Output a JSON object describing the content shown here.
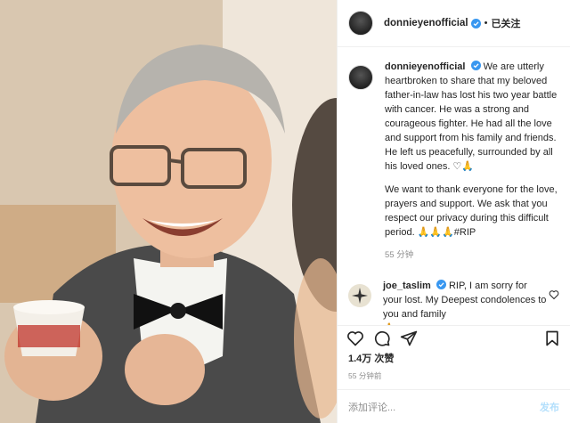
{
  "photo": {
    "alt_icon": "photo-portrait"
  },
  "header": {
    "username": "donnieyenofficial",
    "dot": "•",
    "follow": "已关注"
  },
  "caption": {
    "username": "donnieyenofficial",
    "para1": "We are utterly heartbroken to share that my beloved father-in-law has lost his two year battle with cancer. He was a strong and courageous fighter. He had all the love and support from his family and friends. He left us peacefully, surrounded by all his loved ones. ♡🙏",
    "para2": "We want to thank everyone for the love, prayers and support. We ask that you respect our privacy during this difficult period. 🙏🙏🙏#RIP",
    "time": "55 分钟"
  },
  "comment": {
    "username": "joe_taslim",
    "text": "RIP, I am sorry for your lost. My Deepest condolences to you and family",
    "emoji": "🙏"
  },
  "likes": "1.4万 次赞",
  "posted": "55 分钟前",
  "add_comment": {
    "placeholder": "添加评论...",
    "send": "发布"
  },
  "colors": {
    "verified": "#3897f0",
    "link": "#00376b",
    "muted": "#8e8e8e"
  }
}
